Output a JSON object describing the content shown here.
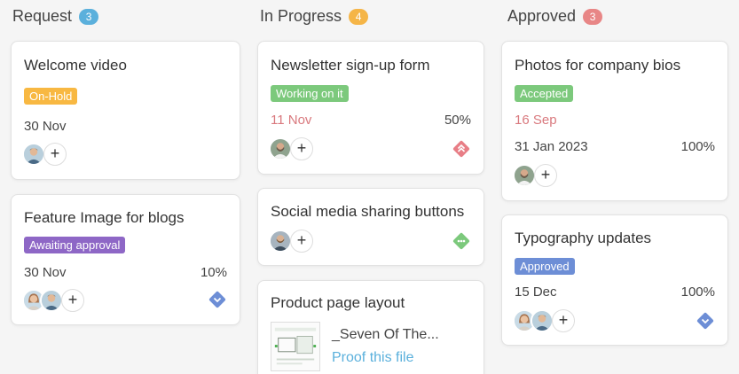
{
  "colors": {
    "count_request": "#5bb0dc",
    "count_progress": "#f5b547",
    "count_approved": "#e88686",
    "tag_onhold": "#f8b842",
    "tag_working": "#7cc97c",
    "tag_awaiting": "#8e67c6",
    "tag_accepted": "#7cc97c",
    "tag_approved": "#6d8ed6",
    "prio_high": "#e87e86",
    "prio_medium": "#7cc97c",
    "prio_low": "#6d8ed6"
  },
  "columns": [
    {
      "title": "Request",
      "count": "3",
      "cards": [
        {
          "title": "Welcome video",
          "tag": "On-Hold",
          "date": "30 Nov",
          "avatars": [
            "man-avatar"
          ]
        },
        {
          "title": "Feature Image for blogs",
          "tag": "Awaiting approval",
          "date": "30 Nov",
          "percent": "10%",
          "avatars": [
            "woman-avatar",
            "man-avatar"
          ],
          "priority": "low-priority-icon"
        }
      ]
    },
    {
      "title": "In Progress",
      "count": "4",
      "cards": [
        {
          "title": "Newsletter sign-up form",
          "tag": "Working on it",
          "date": "11 Nov",
          "percent": "50%",
          "avatars": [
            "man-avatar"
          ],
          "priority": "high-priority-icon"
        },
        {
          "title": "Social media sharing buttons",
          "avatars": [
            "man-avatar"
          ],
          "priority": "medium-priority-icon"
        },
        {
          "title": "Product page layout",
          "file_name": "_Seven Of The...",
          "link": "Proof this file"
        }
      ]
    },
    {
      "title": "Approved",
      "count": "3",
      "cards": [
        {
          "title": "Photos for company bios",
          "tag": "Accepted",
          "date": "16 Sep",
          "date2": "31 Jan 2023",
          "percent": "100%",
          "avatars": [
            "man-avatar"
          ]
        },
        {
          "title": "Typography updates",
          "tag": "Approved",
          "date": "15 Dec",
          "percent": "100%",
          "avatars": [
            "woman-avatar",
            "man-avatar"
          ],
          "priority": "low-priority-icon"
        }
      ]
    }
  ],
  "add_label": "+"
}
